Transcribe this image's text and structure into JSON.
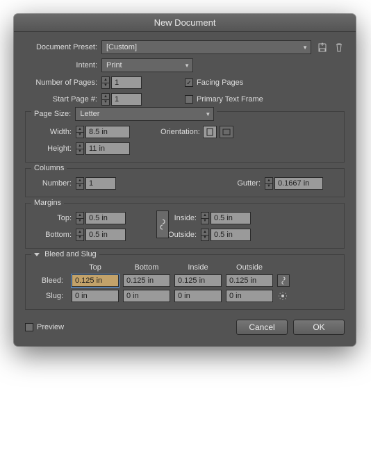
{
  "window": {
    "title": "New Document"
  },
  "preset": {
    "label": "Document Preset:",
    "value": "[Custom]"
  },
  "intent": {
    "label": "Intent:",
    "value": "Print"
  },
  "pages": {
    "label": "Number of Pages:",
    "value": "1"
  },
  "start": {
    "label": "Start Page #:",
    "value": "1"
  },
  "facing": {
    "label": "Facing Pages",
    "checked": "✓"
  },
  "ptf": {
    "label": "Primary Text Frame",
    "checked": ""
  },
  "pageSize": {
    "label": "Page Size:",
    "value": "Letter"
  },
  "width": {
    "label": "Width:",
    "value": "8.5 in"
  },
  "height": {
    "label": "Height:",
    "value": "11 in"
  },
  "orientation": {
    "label": "Orientation:"
  },
  "columns": {
    "group": "Columns",
    "number": {
      "label": "Number:",
      "value": "1"
    },
    "gutter": {
      "label": "Gutter:",
      "value": "0.1667 in"
    }
  },
  "margins": {
    "group": "Margins",
    "top": {
      "label": "Top:",
      "value": "0.5 in"
    },
    "bottom": {
      "label": "Bottom:",
      "value": "0.5 in"
    },
    "inside": {
      "label": "Inside:",
      "value": "0.5 in"
    },
    "outside": {
      "label": "Outside:",
      "value": "0.5 in"
    }
  },
  "bleedslug": {
    "group": "Bleed and Slug",
    "headers": {
      "top": "Top",
      "bottom": "Bottom",
      "inside": "Inside",
      "outside": "Outside"
    },
    "bleed": {
      "label": "Bleed:",
      "top": "0.125 in",
      "bottom": "0.125 in",
      "inside": "0.125 in",
      "outside": "0.125 in"
    },
    "slug": {
      "label": "Slug:",
      "top": "0 in",
      "bottom": "0 in",
      "inside": "0 in",
      "outside": "0 in"
    }
  },
  "preview": {
    "label": "Preview",
    "checked": ""
  },
  "buttons": {
    "cancel": "Cancel",
    "ok": "OK"
  },
  "icons": {
    "save_preset": "save-preset-icon",
    "delete_preset": "trash-icon",
    "orientation_portrait": "portrait-icon",
    "orientation_landscape": "landscape-icon",
    "link": "link-icon",
    "link2": "link-icon",
    "slug_toggle": "slug-visibility-icon"
  }
}
